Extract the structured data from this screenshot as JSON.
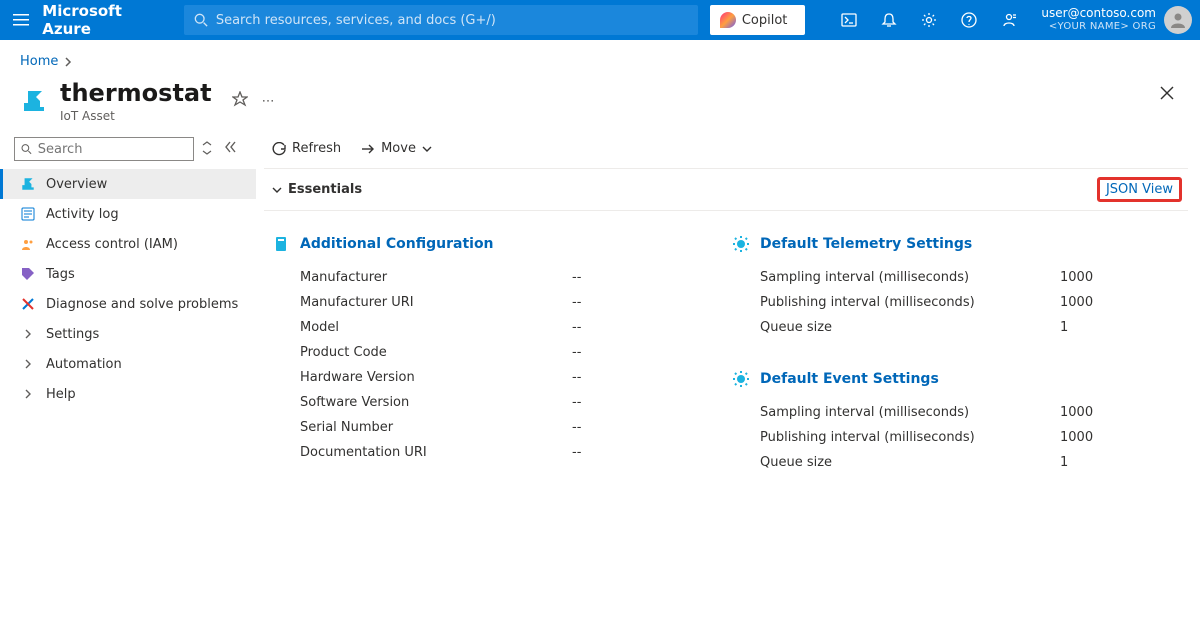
{
  "header": {
    "brand": "Microsoft Azure",
    "search_placeholder": "Search resources, services, and docs (G+/)",
    "copilot_label": "Copilot",
    "account_email": "user@contoso.com",
    "account_org": "<YOUR NAME> ORG"
  },
  "breadcrumb": {
    "home": "Home"
  },
  "resource": {
    "title": "thermostat",
    "type": "IoT Asset"
  },
  "leftnav": {
    "search_placeholder": "Search",
    "items": [
      {
        "label": "Overview"
      },
      {
        "label": "Activity log"
      },
      {
        "label": "Access control (IAM)"
      },
      {
        "label": "Tags"
      },
      {
        "label": "Diagnose and solve problems"
      },
      {
        "label": "Settings"
      },
      {
        "label": "Automation"
      },
      {
        "label": "Help"
      }
    ]
  },
  "toolbar": {
    "refresh": "Refresh",
    "move": "Move"
  },
  "essentials": {
    "label": "Essentials",
    "json_view": "JSON View"
  },
  "cards": {
    "config": {
      "title": "Additional Configuration",
      "rows": [
        {
          "label": "Manufacturer",
          "value": "--"
        },
        {
          "label": "Manufacturer URI",
          "value": "--"
        },
        {
          "label": "Model",
          "value": "--"
        },
        {
          "label": "Product Code",
          "value": "--"
        },
        {
          "label": "Hardware Version",
          "value": "--"
        },
        {
          "label": "Software Version",
          "value": "--"
        },
        {
          "label": "Serial Number",
          "value": "--"
        },
        {
          "label": "Documentation URI",
          "value": "--"
        }
      ]
    },
    "telemetry": {
      "title": "Default Telemetry Settings",
      "rows": [
        {
          "label": "Sampling interval (milliseconds)",
          "value": "1000"
        },
        {
          "label": "Publishing interval (milliseconds)",
          "value": "1000"
        },
        {
          "label": "Queue size",
          "value": "1"
        }
      ]
    },
    "events": {
      "title": "Default Event Settings",
      "rows": [
        {
          "label": "Sampling interval (milliseconds)",
          "value": "1000"
        },
        {
          "label": "Publishing interval (milliseconds)",
          "value": "1000"
        },
        {
          "label": "Queue size",
          "value": "1"
        }
      ]
    }
  }
}
